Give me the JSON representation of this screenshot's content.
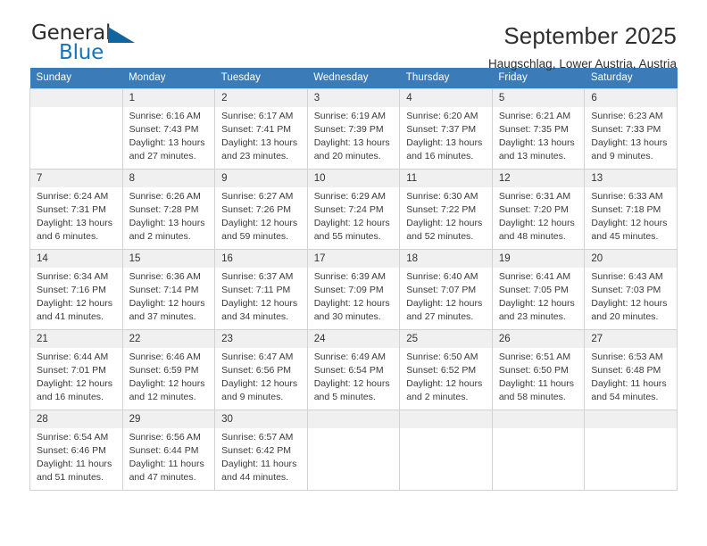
{
  "brand": {
    "name_top": "General",
    "name_bottom": "Blue",
    "triangle_color": "#11659f",
    "blue_color": "#1573ba"
  },
  "header": {
    "title": "September 2025",
    "subtitle": "Haugschlag, Lower Austria, Austria"
  },
  "theme": {
    "header_bg": "#3b7cb8",
    "header_text": "#ffffff",
    "daynum_bg": "#f0f0f0",
    "cell_border": "#d2d2d2"
  },
  "weekdays": [
    "Sunday",
    "Monday",
    "Tuesday",
    "Wednesday",
    "Thursday",
    "Friday",
    "Saturday"
  ],
  "weeks": [
    [
      {
        "day": "",
        "empty": true,
        "lines": []
      },
      {
        "day": "1",
        "lines": [
          "Sunrise: 6:16 AM",
          "Sunset: 7:43 PM",
          "Daylight: 13 hours",
          "and 27 minutes."
        ]
      },
      {
        "day": "2",
        "lines": [
          "Sunrise: 6:17 AM",
          "Sunset: 7:41 PM",
          "Daylight: 13 hours",
          "and 23 minutes."
        ]
      },
      {
        "day": "3",
        "lines": [
          "Sunrise: 6:19 AM",
          "Sunset: 7:39 PM",
          "Daylight: 13 hours",
          "and 20 minutes."
        ]
      },
      {
        "day": "4",
        "lines": [
          "Sunrise: 6:20 AM",
          "Sunset: 7:37 PM",
          "Daylight: 13 hours",
          "and 16 minutes."
        ]
      },
      {
        "day": "5",
        "lines": [
          "Sunrise: 6:21 AM",
          "Sunset: 7:35 PM",
          "Daylight: 13 hours",
          "and 13 minutes."
        ]
      },
      {
        "day": "6",
        "lines": [
          "Sunrise: 6:23 AM",
          "Sunset: 7:33 PM",
          "Daylight: 13 hours",
          "and 9 minutes."
        ]
      }
    ],
    [
      {
        "day": "7",
        "lines": [
          "Sunrise: 6:24 AM",
          "Sunset: 7:31 PM",
          "Daylight: 13 hours",
          "and 6 minutes."
        ]
      },
      {
        "day": "8",
        "lines": [
          "Sunrise: 6:26 AM",
          "Sunset: 7:28 PM",
          "Daylight: 13 hours",
          "and 2 minutes."
        ]
      },
      {
        "day": "9",
        "lines": [
          "Sunrise: 6:27 AM",
          "Sunset: 7:26 PM",
          "Daylight: 12 hours",
          "and 59 minutes."
        ]
      },
      {
        "day": "10",
        "lines": [
          "Sunrise: 6:29 AM",
          "Sunset: 7:24 PM",
          "Daylight: 12 hours",
          "and 55 minutes."
        ]
      },
      {
        "day": "11",
        "lines": [
          "Sunrise: 6:30 AM",
          "Sunset: 7:22 PM",
          "Daylight: 12 hours",
          "and 52 minutes."
        ]
      },
      {
        "day": "12",
        "lines": [
          "Sunrise: 6:31 AM",
          "Sunset: 7:20 PM",
          "Daylight: 12 hours",
          "and 48 minutes."
        ]
      },
      {
        "day": "13",
        "lines": [
          "Sunrise: 6:33 AM",
          "Sunset: 7:18 PM",
          "Daylight: 12 hours",
          "and 45 minutes."
        ]
      }
    ],
    [
      {
        "day": "14",
        "lines": [
          "Sunrise: 6:34 AM",
          "Sunset: 7:16 PM",
          "Daylight: 12 hours",
          "and 41 minutes."
        ]
      },
      {
        "day": "15",
        "lines": [
          "Sunrise: 6:36 AM",
          "Sunset: 7:14 PM",
          "Daylight: 12 hours",
          "and 37 minutes."
        ]
      },
      {
        "day": "16",
        "lines": [
          "Sunrise: 6:37 AM",
          "Sunset: 7:11 PM",
          "Daylight: 12 hours",
          "and 34 minutes."
        ]
      },
      {
        "day": "17",
        "lines": [
          "Sunrise: 6:39 AM",
          "Sunset: 7:09 PM",
          "Daylight: 12 hours",
          "and 30 minutes."
        ]
      },
      {
        "day": "18",
        "lines": [
          "Sunrise: 6:40 AM",
          "Sunset: 7:07 PM",
          "Daylight: 12 hours",
          "and 27 minutes."
        ]
      },
      {
        "day": "19",
        "lines": [
          "Sunrise: 6:41 AM",
          "Sunset: 7:05 PM",
          "Daylight: 12 hours",
          "and 23 minutes."
        ]
      },
      {
        "day": "20",
        "lines": [
          "Sunrise: 6:43 AM",
          "Sunset: 7:03 PM",
          "Daylight: 12 hours",
          "and 20 minutes."
        ]
      }
    ],
    [
      {
        "day": "21",
        "lines": [
          "Sunrise: 6:44 AM",
          "Sunset: 7:01 PM",
          "Daylight: 12 hours",
          "and 16 minutes."
        ]
      },
      {
        "day": "22",
        "lines": [
          "Sunrise: 6:46 AM",
          "Sunset: 6:59 PM",
          "Daylight: 12 hours",
          "and 12 minutes."
        ]
      },
      {
        "day": "23",
        "lines": [
          "Sunrise: 6:47 AM",
          "Sunset: 6:56 PM",
          "Daylight: 12 hours",
          "and 9 minutes."
        ]
      },
      {
        "day": "24",
        "lines": [
          "Sunrise: 6:49 AM",
          "Sunset: 6:54 PM",
          "Daylight: 12 hours",
          "and 5 minutes."
        ]
      },
      {
        "day": "25",
        "lines": [
          "Sunrise: 6:50 AM",
          "Sunset: 6:52 PM",
          "Daylight: 12 hours",
          "and 2 minutes."
        ]
      },
      {
        "day": "26",
        "lines": [
          "Sunrise: 6:51 AM",
          "Sunset: 6:50 PM",
          "Daylight: 11 hours",
          "and 58 minutes."
        ]
      },
      {
        "day": "27",
        "lines": [
          "Sunrise: 6:53 AM",
          "Sunset: 6:48 PM",
          "Daylight: 11 hours",
          "and 54 minutes."
        ]
      }
    ],
    [
      {
        "day": "28",
        "lines": [
          "Sunrise: 6:54 AM",
          "Sunset: 6:46 PM",
          "Daylight: 11 hours",
          "and 51 minutes."
        ]
      },
      {
        "day": "29",
        "lines": [
          "Sunrise: 6:56 AM",
          "Sunset: 6:44 PM",
          "Daylight: 11 hours",
          "and 47 minutes."
        ]
      },
      {
        "day": "30",
        "lines": [
          "Sunrise: 6:57 AM",
          "Sunset: 6:42 PM",
          "Daylight: 11 hours",
          "and 44 minutes."
        ]
      },
      {
        "day": "",
        "empty": true,
        "lines": []
      },
      {
        "day": "",
        "empty": true,
        "lines": []
      },
      {
        "day": "",
        "empty": true,
        "lines": []
      },
      {
        "day": "",
        "empty": true,
        "lines": []
      }
    ]
  ]
}
